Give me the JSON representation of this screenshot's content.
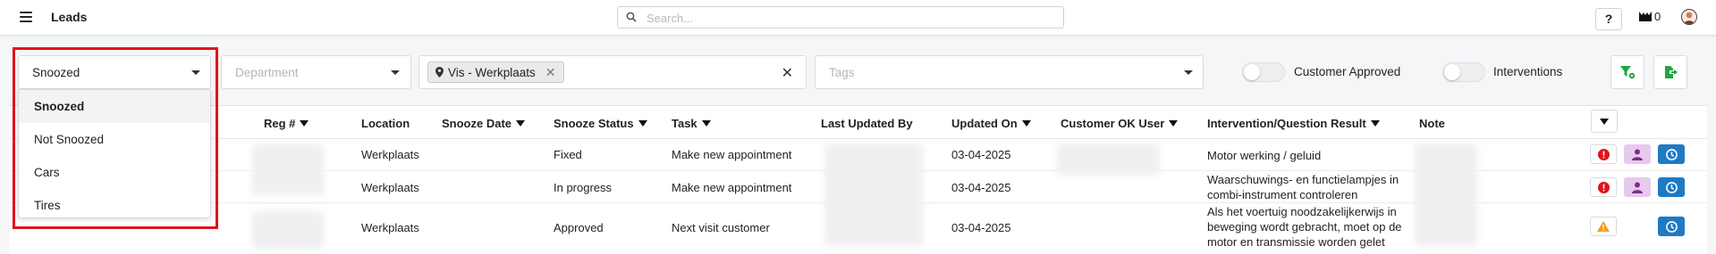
{
  "header": {
    "title": "Leads",
    "search_placeholder": "Search...",
    "help_label": "?",
    "inbox_count": "0"
  },
  "filters": {
    "status_value": "Snoozed",
    "department_placeholder": "Department",
    "location_chip": "Vis - Werkplaats",
    "tags_placeholder": "Tags",
    "toggle_customer_approved": "Customer Approved",
    "toggle_interventions": "Interventions",
    "status_options": [
      "Snoozed",
      "Not Snoozed",
      "Cars",
      "Tires"
    ]
  },
  "table": {
    "columns": [
      "Reg #",
      "Location",
      "Snooze Date",
      "Snooze Status",
      "Task",
      "Last Updated By",
      "Updated On",
      "Customer OK User",
      "Intervention/Question Result",
      "Note"
    ],
    "rows": [
      {
        "location": "Werkplaats",
        "snooze_status": "Fixed",
        "task": "Make new appointment",
        "updated_on": "03-04-2025",
        "result": "Motor werking / geluid"
      },
      {
        "location": "Werkplaats",
        "snooze_status": "In progress",
        "task": "Make new appointment",
        "updated_on": "03-04-2025",
        "result": "Waarschuwings- en functielampjes in combi-instrument controleren"
      },
      {
        "location": "Werkplaats",
        "snooze_status": "Approved",
        "task": "Next visit customer",
        "updated_on": "03-04-2025",
        "result": "Als het voertuig noodzakelijkerwijs in beweging wordt gebracht, moet op de motor en transmissie worden gelet"
      }
    ]
  },
  "colors": {
    "accent_blue": "#1f7ac4",
    "purple_bg": "#e7c9ee",
    "danger_red": "#e0141c",
    "warning_orange": "#f0a020",
    "green_icon": "#22a745"
  }
}
